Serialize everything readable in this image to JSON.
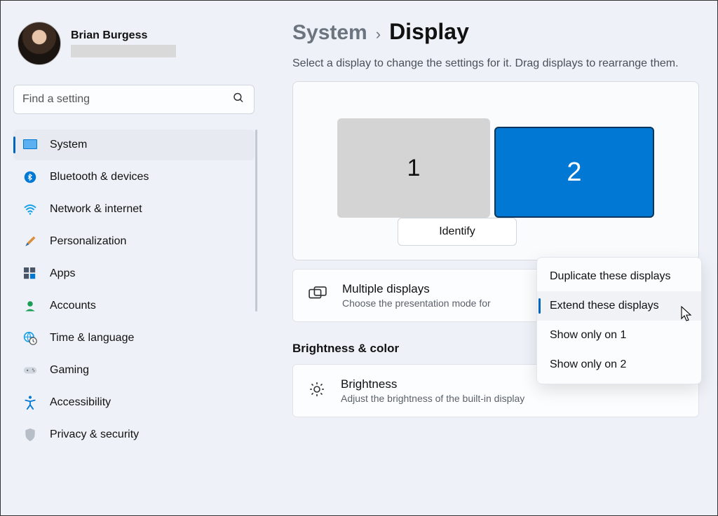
{
  "user": {
    "name": "Brian Burgess"
  },
  "search": {
    "placeholder": "Find a setting"
  },
  "nav": {
    "items": [
      {
        "label": "System"
      },
      {
        "label": "Bluetooth & devices"
      },
      {
        "label": "Network & internet"
      },
      {
        "label": "Personalization"
      },
      {
        "label": "Apps"
      },
      {
        "label": "Accounts"
      },
      {
        "label": "Time & language"
      },
      {
        "label": "Gaming"
      },
      {
        "label": "Accessibility"
      },
      {
        "label": "Privacy & security"
      }
    ]
  },
  "breadcrumb": {
    "parent": "System",
    "current": "Display"
  },
  "display_hint": "Select a display to change the settings for it. Drag displays to rearrange them.",
  "monitors": {
    "m1": "1",
    "m2": "2"
  },
  "identify_label": "Identify",
  "dropdown": {
    "items": [
      "Duplicate these displays",
      "Extend these displays",
      "Show only on 1",
      "Show only on 2"
    ],
    "selected_index": 1
  },
  "multiple_displays": {
    "title": "Multiple displays",
    "sub": "Choose the presentation mode for"
  },
  "section_brightness": "Brightness & color",
  "brightness": {
    "title": "Brightness",
    "sub": "Adjust the brightness of the built-in display"
  }
}
